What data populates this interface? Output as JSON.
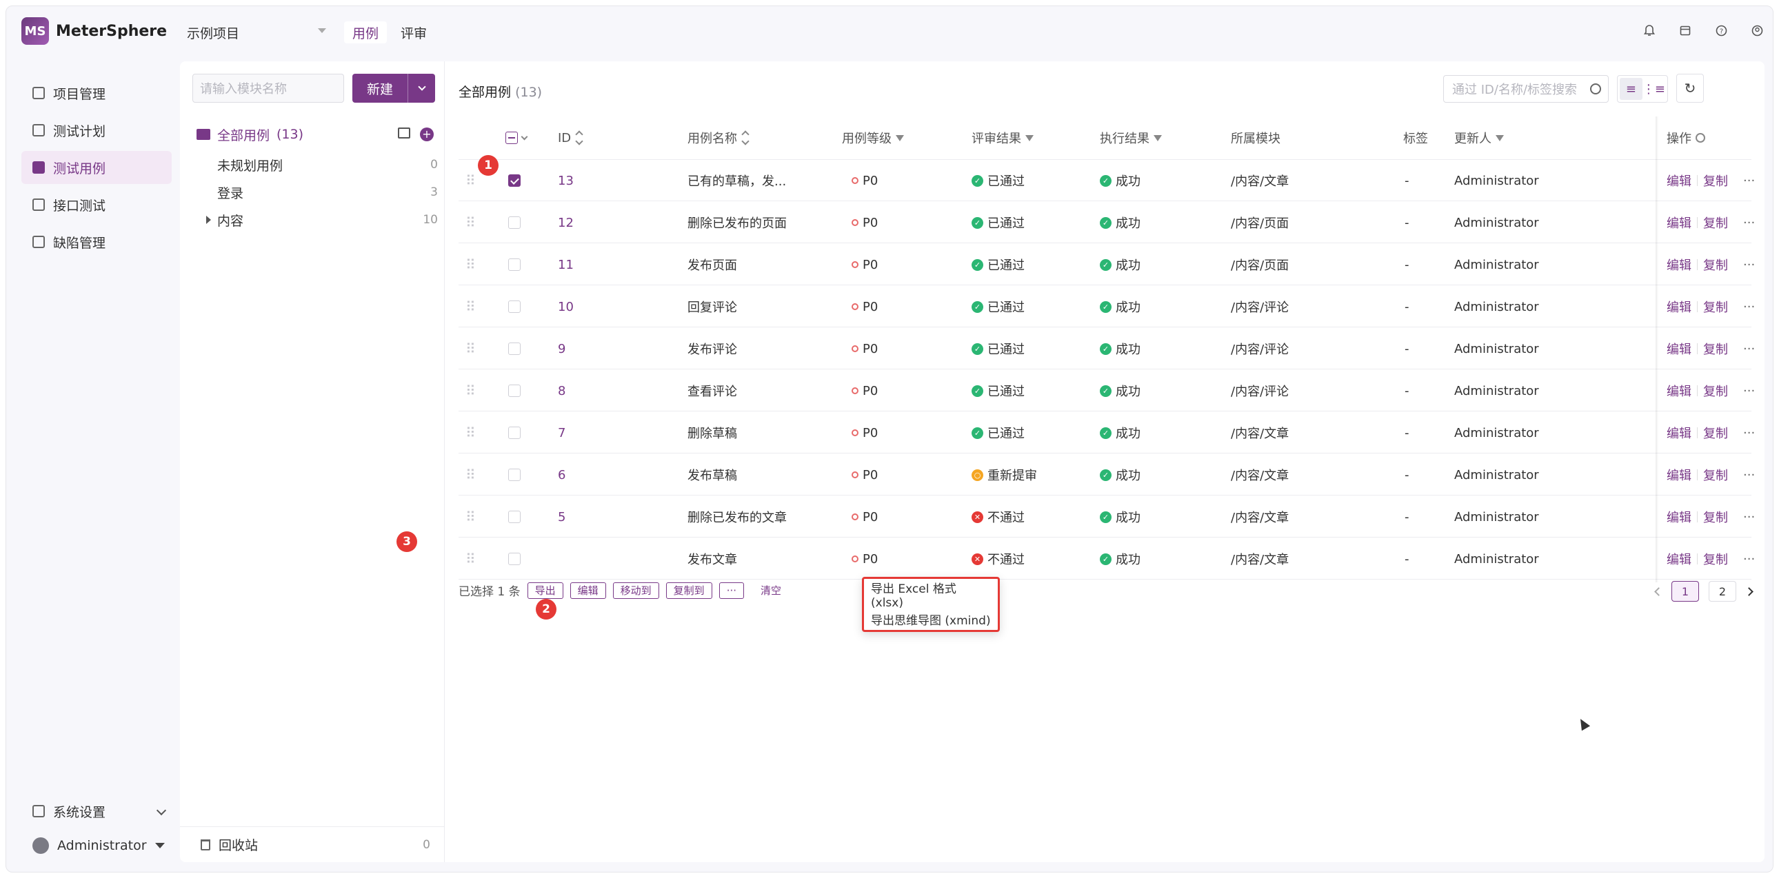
{
  "app": {
    "logo_text": "MeterSphere",
    "logo_mark": "MS"
  },
  "header": {
    "project": "示例项目",
    "tabs": [
      {
        "label": "用例",
        "active": true
      },
      {
        "label": "评审",
        "active": false
      }
    ],
    "icons": [
      "bell-icon",
      "calendar-icon",
      "help-icon",
      "user-circle-icon"
    ]
  },
  "sidebar": {
    "items": [
      {
        "label": "项目管理",
        "icon": "project-icon",
        "active": false
      },
      {
        "label": "测试计划",
        "icon": "plan-icon",
        "active": false
      },
      {
        "label": "测试用例",
        "icon": "case-icon",
        "active": true
      },
      {
        "label": "接口测试",
        "icon": "api-icon",
        "active": false
      },
      {
        "label": "缺陷管理",
        "icon": "bug-icon",
        "active": false
      }
    ],
    "settings_label": "系统设置",
    "user_label": "Administrator"
  },
  "modules": {
    "search_placeholder": "请输入模块名称",
    "new_label": "新建",
    "root": {
      "label": "全部用例",
      "count": "(13)"
    },
    "nodes": [
      {
        "label": "未规划用例",
        "count": "0"
      },
      {
        "label": "登录",
        "count": "3"
      },
      {
        "label": "内容",
        "count": "10"
      }
    ],
    "recycle": {
      "label": "回收站",
      "count": "0"
    }
  },
  "main": {
    "title": "全部用例",
    "title_count": "(13)",
    "search_placeholder": "通过 ID/名称/标签搜索",
    "columns": {
      "id": "ID",
      "name": "用例名称",
      "level": "用例等级",
      "review": "评审结果",
      "exec": "执行结果",
      "module": "所属模块",
      "tags": "标签",
      "updater": "更新人",
      "ops": "操作"
    },
    "op_labels": {
      "edit": "编辑",
      "copy": "复制",
      "more": "···"
    },
    "rows": [
      {
        "id": "13",
        "name": "已有的草稿，发...",
        "level": "P0",
        "review": "已通过",
        "review_state": "pass",
        "exec": "成功",
        "module": "/内容/文章",
        "tags": "-",
        "updater": "Administrator",
        "checked": true
      },
      {
        "id": "12",
        "name": "删除已发布的页面",
        "level": "P0",
        "review": "已通过",
        "review_state": "pass",
        "exec": "成功",
        "module": "/内容/页面",
        "tags": "-",
        "updater": "Administrator",
        "checked": false
      },
      {
        "id": "11",
        "name": "发布页面",
        "level": "P0",
        "review": "已通过",
        "review_state": "pass",
        "exec": "成功",
        "module": "/内容/页面",
        "tags": "-",
        "updater": "Administrator",
        "checked": false
      },
      {
        "id": "10",
        "name": "回复评论",
        "level": "P0",
        "review": "已通过",
        "review_state": "pass",
        "exec": "成功",
        "module": "/内容/评论",
        "tags": "-",
        "updater": "Administrator",
        "checked": false
      },
      {
        "id": "9",
        "name": "发布评论",
        "level": "P0",
        "review": "已通过",
        "review_state": "pass",
        "exec": "成功",
        "module": "/内容/评论",
        "tags": "-",
        "updater": "Administrator",
        "checked": false
      },
      {
        "id": "8",
        "name": "查看评论",
        "level": "P0",
        "review": "已通过",
        "review_state": "pass",
        "exec": "成功",
        "module": "/内容/评论",
        "tags": "-",
        "updater": "Administrator",
        "checked": false
      },
      {
        "id": "7",
        "name": "删除草稿",
        "level": "P0",
        "review": "已通过",
        "review_state": "pass",
        "exec": "成功",
        "module": "/内容/文章",
        "tags": "-",
        "updater": "Administrator",
        "checked": false
      },
      {
        "id": "6",
        "name": "发布草稿",
        "level": "P0",
        "review": "重新提审",
        "review_state": "resubmit",
        "exec": "成功",
        "module": "/内容/文章",
        "tags": "-",
        "updater": "Administrator",
        "checked": false
      },
      {
        "id": "5",
        "name": "删除已发布的文章",
        "level": "P0",
        "review": "不通过",
        "review_state": "fail",
        "exec": "成功",
        "module": "/内容/文章",
        "tags": "-",
        "updater": "Administrator",
        "checked": false
      },
      {
        "id": "",
        "name": "发布文章",
        "level": "P0",
        "review": "不通过",
        "review_state": "fail",
        "exec": "成功",
        "module": "/内容/文章",
        "tags": "-",
        "updater": "Administrator",
        "checked": false
      }
    ]
  },
  "batch": {
    "selected_text": "已选择 1 条",
    "buttons": [
      "导出",
      "编辑",
      "移动到",
      "复制到",
      "···"
    ],
    "clear_label": "清空"
  },
  "pagination": {
    "pages": [
      "1",
      "2"
    ],
    "current": "1"
  },
  "export_menu": {
    "items": [
      "导出 Excel 格式 (xlsx)",
      "导出思维导图 (xmind)"
    ]
  },
  "markers": [
    "1",
    "2",
    "3"
  ],
  "colors": {
    "accent": "#783887",
    "pass": "#2bb673",
    "fail": "#e53935",
    "resubmit": "#f5a623",
    "marker": "#e53935"
  }
}
